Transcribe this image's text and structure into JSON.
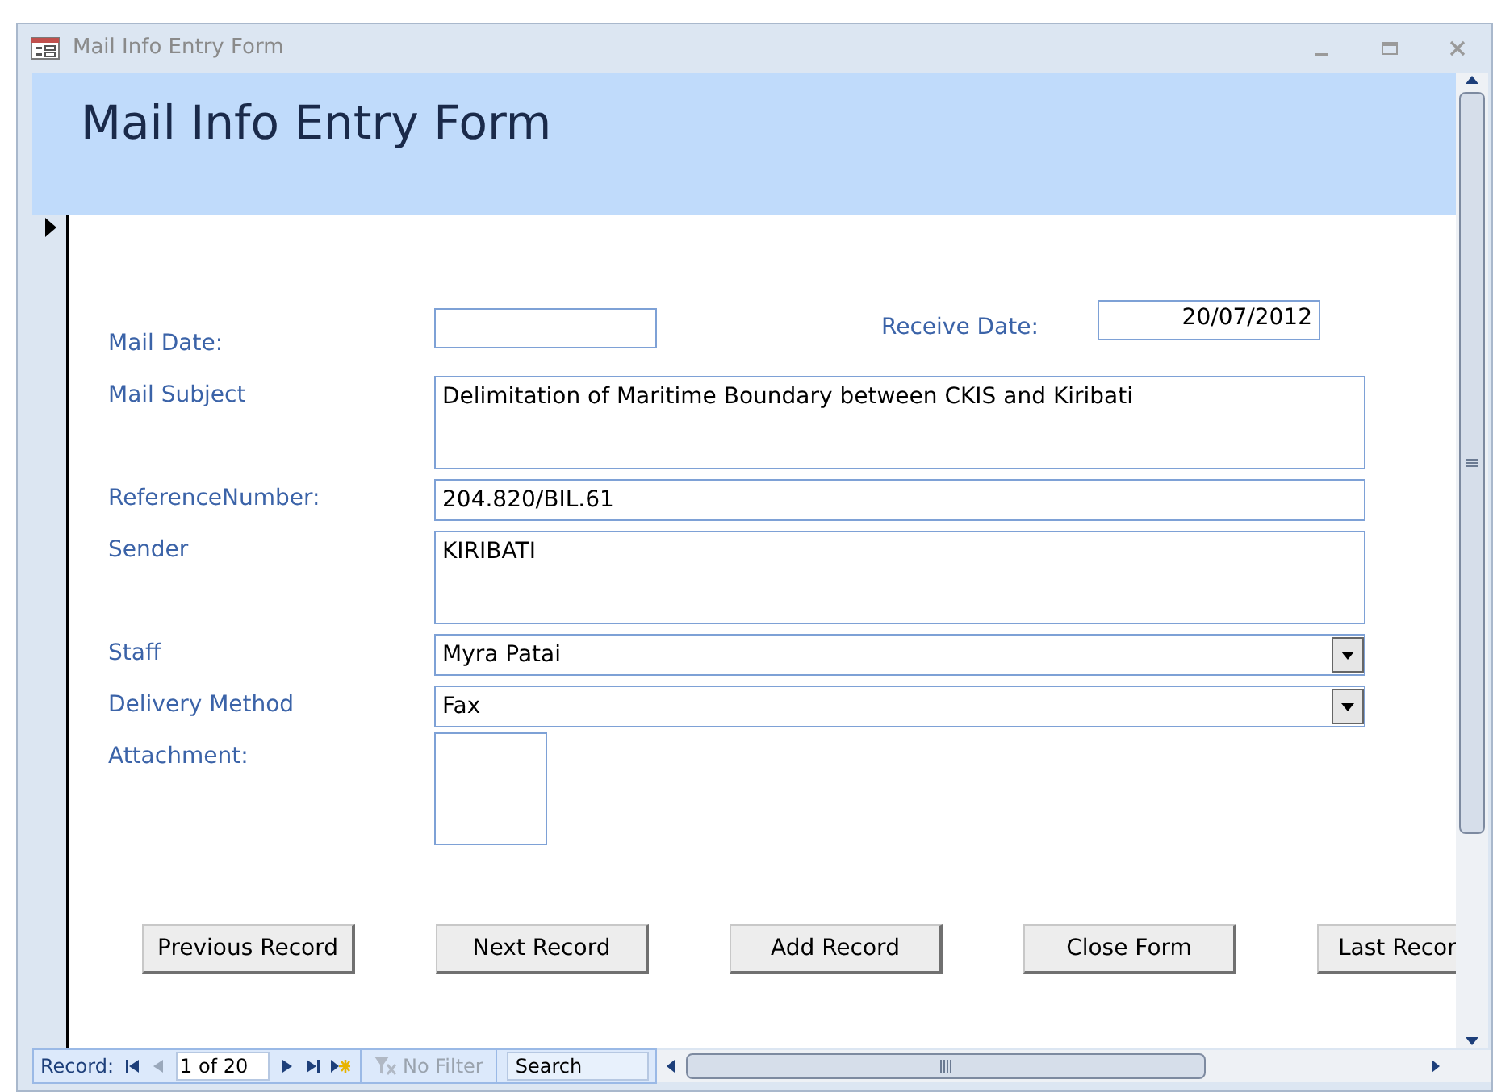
{
  "window": {
    "title": "Mail Info Entry Form"
  },
  "header": {
    "title": "Mail Info Entry Form"
  },
  "mail_date": {
    "label": "Mail Date:"
  },
  "receive_date": {
    "label": "Receive Date:",
    "value": "20/07/2012"
  },
  "fields": [
    {
      "kind": "memo",
      "label": "Mail Subject",
      "value": "Delimitation of Maritime Boundary between CKIS and Kiribati"
    },
    {
      "kind": "text",
      "label": "ReferenceNumber:",
      "value": "204.820/BIL.61"
    },
    {
      "kind": "memo",
      "label": "Sender",
      "value": "KIRIBATI"
    },
    {
      "kind": "combo",
      "label": "Staff",
      "value": "Myra Patai"
    },
    {
      "kind": "combo",
      "label": "Delivery Method",
      "value": "Fax"
    },
    {
      "kind": "attachment",
      "label": "Attachment:"
    }
  ],
  "buttons": [
    "Previous Record",
    "Next Record",
    "Add Record",
    "Close Form",
    "Last Recor"
  ],
  "navigation": {
    "label": "Record:",
    "position": "1 of 20",
    "previous_disabled": true,
    "filter": {
      "label": "No Filter",
      "disabled": true
    },
    "search": {
      "placeholder": "Search"
    }
  }
}
